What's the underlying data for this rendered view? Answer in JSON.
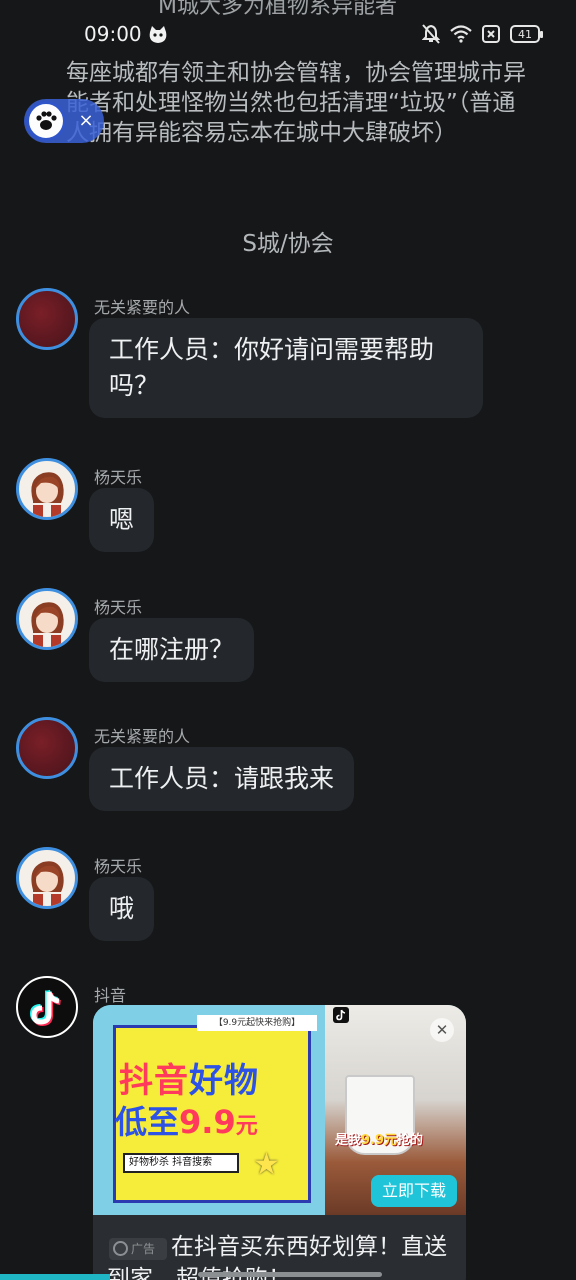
{
  "status_bar": {
    "time": "09:00",
    "battery": "41"
  },
  "story": {
    "top_line": "M城大多为植物系异能者",
    "paragraph": "每座城都有领主和协会管辖，协会管理城市异能者和处理怪物当然也包括清理“垃圾”（普通人拥有异能容易忘本在城中大肆破坏）",
    "scene": "S城/协会"
  },
  "floating_button": {
    "close": "×"
  },
  "messages": [
    {
      "sender": "无关紧要的人",
      "text": "工作人员：你好请问需要帮助吗？",
      "avatar": "red"
    },
    {
      "sender": "杨天乐",
      "text": "嗯",
      "avatar": "boy"
    },
    {
      "sender": "杨天乐",
      "text": "在哪注册？",
      "avatar": "boy"
    },
    {
      "sender": "无关紧要的人",
      "text": "工作人员：请跟我来",
      "avatar": "red"
    },
    {
      "sender": "杨天乐",
      "text": "哦",
      "avatar": "boy"
    }
  ],
  "ad": {
    "sender": "抖音",
    "tag": "【9.9元起快来抢购】",
    "headline_a": "抖音",
    "headline_b": "好物",
    "headline_c": "低至",
    "headline_price": "9.9",
    "headline_unit": "元",
    "search_text": "好物秒杀 抖音搜索",
    "right_text_a": "是我",
    "right_text_price": "9.9元",
    "right_text_b": "抢的",
    "download_label": "立即下载",
    "badge_label": "广告",
    "caption": "在抖音买东西好划算！直送到家，超值抢购！",
    "colors": {
      "accent": "#20c4d9",
      "yellow": "#f6ec3a",
      "red": "#ff3a5c",
      "blue": "#2d52e6"
    }
  }
}
